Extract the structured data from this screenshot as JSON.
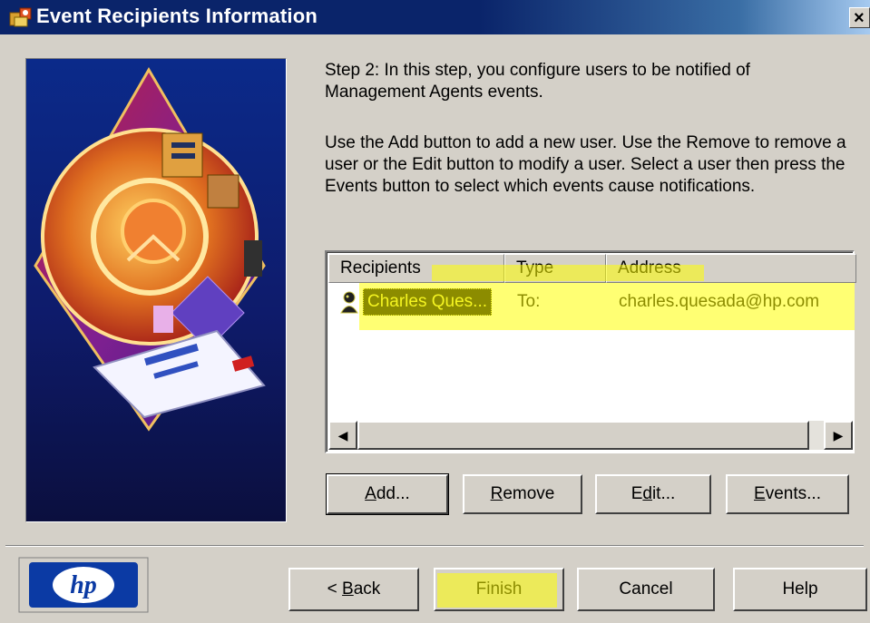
{
  "window": {
    "title": "Event Recipients Information",
    "close_glyph": "×"
  },
  "intro": {
    "step_text": "Step 2:  In this step, you configure users to be notified of Management Agents events.",
    "instructions_text": "Use the Add button to add a new user. Use the Remove to remove a user or the Edit button to modify a user. Select a user then press the Events button to select which events cause notifications."
  },
  "recipients_list": {
    "columns": [
      "Recipients",
      "Type",
      "Address"
    ],
    "rows": [
      {
        "name": "Charles Ques...",
        "type": "To:",
        "address": "charles.quesada@hp.com",
        "icon": "user-icon"
      }
    ]
  },
  "list_buttons": {
    "add": {
      "label": "Add...",
      "mnemonic": "A"
    },
    "remove": {
      "label": "Remove",
      "mnemonic": "R"
    },
    "edit": {
      "label": "Edit...",
      "mnemonic": "d"
    },
    "events": {
      "label": "Events...",
      "mnemonic": "E"
    }
  },
  "wizard_buttons": {
    "back": "< Back",
    "finish": "Finish",
    "cancel": "Cancel",
    "help": "Help"
  },
  "brand": {
    "logo_text": "hp"
  },
  "colors": {
    "titlebar_start": "#0a246a",
    "titlebar_end": "#a6caf0",
    "dialog_face": "#d4d0c8",
    "selection_bg": "#000000",
    "highlighter": "#ffff00",
    "hp_blue": "#0b3aa4"
  }
}
